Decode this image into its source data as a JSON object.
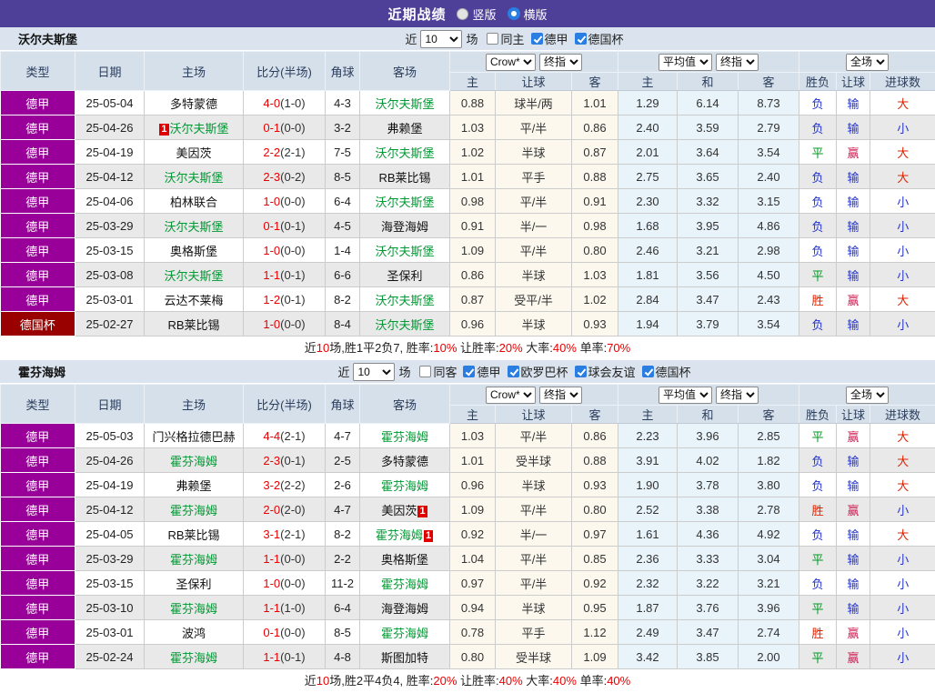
{
  "title_bar": {
    "title": "近期战绩",
    "radios": [
      {
        "label": "竖版",
        "checked": false,
        "name": "vertical-layout-radio"
      },
      {
        "label": "横版",
        "checked": true,
        "name": "horizontal-layout-radio"
      }
    ]
  },
  "colors": {
    "topbar_bg": "#4e4099",
    "accent_blue": "#2a7de1",
    "filter_bar_bg": "#dbe4ee",
    "header_bg": "#d6e0ea",
    "row_alt_bg": "#e9e9e9",
    "handicap_col_bg": "#fcf8ee",
    "avg_col_bg": "#e8f3fa",
    "self_team_green": "#009933",
    "score_red": "#e80000",
    "league": {
      "德甲": "#990099",
      "德国杯": "#990000"
    },
    "result": {
      "胜": "#dd2200",
      "平": "#009922",
      "负": "#2233cc",
      "赢": "#cc2255",
      "输": "#2233cc",
      "大": "#dd2200",
      "小": "#2233cc"
    }
  },
  "table_headers": {
    "fixed": [
      "类型",
      "日期",
      "主场",
      "比分(半场)",
      "角球",
      "客场"
    ],
    "sub": [
      "主",
      "让球",
      "客",
      "主",
      "和",
      "客",
      "胜负",
      "让球",
      "进球数"
    ]
  },
  "header_groups": [
    {
      "name": "handicap-odds-group",
      "selects": [
        {
          "label": "Crow*",
          "name": "bookmaker-select"
        },
        {
          "label": "终指",
          "name": "handicap-time-select"
        }
      ]
    },
    {
      "name": "average-odds-group",
      "selects": [
        {
          "label": "平均值",
          "name": "average-source-select"
        },
        {
          "label": "终指",
          "name": "average-time-select"
        }
      ]
    },
    {
      "name": "result-group",
      "selects": [
        {
          "label": "全场",
          "name": "result-scope-select"
        }
      ]
    }
  ],
  "sections": [
    {
      "team": "沃尔夫斯堡",
      "filter": {
        "near_label": "近",
        "games": "10",
        "games_suffix": "场",
        "checkboxes": [
          {
            "label": "同主",
            "checked": false,
            "name": "same-home-checkbox"
          },
          {
            "label": "德甲",
            "checked": true,
            "name": "league-bundesliga-checkbox"
          },
          {
            "label": "德国杯",
            "checked": true,
            "name": "league-dfb-pokal-checkbox"
          }
        ]
      },
      "rows": [
        {
          "type": "德甲",
          "date": "25-05-04",
          "home": {
            "name": "多特蒙德"
          },
          "score": {
            "ft": "4-0",
            "ht": "(1-0)"
          },
          "corner": "4-3",
          "away": {
            "name": "沃尔夫斯堡",
            "self": true
          },
          "odds": [
            "0.88",
            "球半/两",
            "1.01"
          ],
          "avg": [
            "1.29",
            "6.14",
            "8.73"
          ],
          "results": [
            "负",
            "输",
            "大"
          ]
        },
        {
          "type": "德甲",
          "date": "25-04-26",
          "home": {
            "name": "沃尔夫斯堡",
            "self": true,
            "badge": "1",
            "badge_pos": "before"
          },
          "score": {
            "ft": "0-1",
            "ht": "(0-0)"
          },
          "corner": "3-2",
          "away": {
            "name": "弗赖堡"
          },
          "odds": [
            "1.03",
            "平/半",
            "0.86"
          ],
          "avg": [
            "2.40",
            "3.59",
            "2.79"
          ],
          "results": [
            "负",
            "输",
            "小"
          ]
        },
        {
          "type": "德甲",
          "date": "25-04-19",
          "home": {
            "name": "美因茨"
          },
          "score": {
            "ft": "2-2",
            "ht": "(2-1)"
          },
          "corner": "7-5",
          "away": {
            "name": "沃尔夫斯堡",
            "self": true
          },
          "odds": [
            "1.02",
            "半球",
            "0.87"
          ],
          "avg": [
            "2.01",
            "3.64",
            "3.54"
          ],
          "results": [
            "平",
            "赢",
            "大"
          ]
        },
        {
          "type": "德甲",
          "date": "25-04-12",
          "home": {
            "name": "沃尔夫斯堡",
            "self": true
          },
          "score": {
            "ft": "2-3",
            "ht": "(0-2)"
          },
          "corner": "8-5",
          "away": {
            "name": "RB莱比锡"
          },
          "odds": [
            "1.01",
            "平手",
            "0.88"
          ],
          "avg": [
            "2.75",
            "3.65",
            "2.40"
          ],
          "results": [
            "负",
            "输",
            "大"
          ]
        },
        {
          "type": "德甲",
          "date": "25-04-06",
          "home": {
            "name": "柏林联合"
          },
          "score": {
            "ft": "1-0",
            "ht": "(0-0)"
          },
          "corner": "6-4",
          "away": {
            "name": "沃尔夫斯堡",
            "self": true
          },
          "odds": [
            "0.98",
            "平/半",
            "0.91"
          ],
          "avg": [
            "2.30",
            "3.32",
            "3.15"
          ],
          "results": [
            "负",
            "输",
            "小"
          ]
        },
        {
          "type": "德甲",
          "date": "25-03-29",
          "home": {
            "name": "沃尔夫斯堡",
            "self": true
          },
          "score": {
            "ft": "0-1",
            "ht": "(0-1)"
          },
          "corner": "4-5",
          "away": {
            "name": "海登海姆"
          },
          "odds": [
            "0.91",
            "半/一",
            "0.98"
          ],
          "avg": [
            "1.68",
            "3.95",
            "4.86"
          ],
          "results": [
            "负",
            "输",
            "小"
          ]
        },
        {
          "type": "德甲",
          "date": "25-03-15",
          "home": {
            "name": "奥格斯堡"
          },
          "score": {
            "ft": "1-0",
            "ht": "(0-0)"
          },
          "corner": "1-4",
          "away": {
            "name": "沃尔夫斯堡",
            "self": true
          },
          "odds": [
            "1.09",
            "平/半",
            "0.80"
          ],
          "avg": [
            "2.46",
            "3.21",
            "2.98"
          ],
          "results": [
            "负",
            "输",
            "小"
          ]
        },
        {
          "type": "德甲",
          "date": "25-03-08",
          "home": {
            "name": "沃尔夫斯堡",
            "self": true
          },
          "score": {
            "ft": "1-1",
            "ht": "(0-1)"
          },
          "corner": "6-6",
          "away": {
            "name": "圣保利"
          },
          "odds": [
            "0.86",
            "半球",
            "1.03"
          ],
          "avg": [
            "1.81",
            "3.56",
            "4.50"
          ],
          "results": [
            "平",
            "输",
            "小"
          ]
        },
        {
          "type": "德甲",
          "date": "25-03-01",
          "home": {
            "name": "云达不莱梅"
          },
          "score": {
            "ft": "1-2",
            "ht": "(0-1)"
          },
          "corner": "8-2",
          "away": {
            "name": "沃尔夫斯堡",
            "self": true
          },
          "odds": [
            "0.87",
            "受平/半",
            "1.02"
          ],
          "avg": [
            "2.84",
            "3.47",
            "2.43"
          ],
          "results": [
            "胜",
            "赢",
            "大"
          ]
        },
        {
          "type": "德国杯",
          "date": "25-02-27",
          "home": {
            "name": "RB莱比锡"
          },
          "score": {
            "ft": "1-0",
            "ht": "(0-0)"
          },
          "corner": "8-4",
          "away": {
            "name": "沃尔夫斯堡",
            "self": true
          },
          "odds": [
            "0.96",
            "半球",
            "0.93"
          ],
          "avg": [
            "1.94",
            "3.79",
            "3.54"
          ],
          "results": [
            "负",
            "输",
            "小"
          ]
        }
      ],
      "summary": [
        {
          "text": "近"
        },
        {
          "text": "10",
          "red": true
        },
        {
          "text": "场,胜1平2负7, 胜率:"
        },
        {
          "text": "10%",
          "red": true
        },
        {
          "text": " 让胜率:"
        },
        {
          "text": "20%",
          "red": true
        },
        {
          "text": " 大率:"
        },
        {
          "text": "40%",
          "red": true
        },
        {
          "text": " 单率:"
        },
        {
          "text": "70%",
          "red": true
        }
      ]
    },
    {
      "team": "霍芬海姆",
      "filter": {
        "near_label": "近",
        "games": "10",
        "games_suffix": "场",
        "checkboxes": [
          {
            "label": "同客",
            "checked": false,
            "name": "same-away-checkbox"
          },
          {
            "label": "德甲",
            "checked": true,
            "name": "league-bundesliga-checkbox"
          },
          {
            "label": "欧罗巴杯",
            "checked": true,
            "name": "league-europa-checkbox"
          },
          {
            "label": "球会友谊",
            "checked": true,
            "name": "league-friendly-checkbox"
          },
          {
            "label": "德国杯",
            "checked": true,
            "name": "league-dfb-pokal-checkbox"
          }
        ]
      },
      "rows": [
        {
          "type": "德甲",
          "date": "25-05-03",
          "home": {
            "name": "门兴格拉德巴赫"
          },
          "score": {
            "ft": "4-4",
            "ht": "(2-1)"
          },
          "corner": "4-7",
          "away": {
            "name": "霍芬海姆",
            "self": true
          },
          "odds": [
            "1.03",
            "平/半",
            "0.86"
          ],
          "avg": [
            "2.23",
            "3.96",
            "2.85"
          ],
          "results": [
            "平",
            "赢",
            "大"
          ]
        },
        {
          "type": "德甲",
          "date": "25-04-26",
          "home": {
            "name": "霍芬海姆",
            "self": true
          },
          "score": {
            "ft": "2-3",
            "ht": "(0-1)"
          },
          "corner": "2-5",
          "away": {
            "name": "多特蒙德"
          },
          "odds": [
            "1.01",
            "受半球",
            "0.88"
          ],
          "avg": [
            "3.91",
            "4.02",
            "1.82"
          ],
          "results": [
            "负",
            "输",
            "大"
          ]
        },
        {
          "type": "德甲",
          "date": "25-04-19",
          "home": {
            "name": "弗赖堡"
          },
          "score": {
            "ft": "3-2",
            "ht": "(2-2)"
          },
          "corner": "2-6",
          "away": {
            "name": "霍芬海姆",
            "self": true
          },
          "odds": [
            "0.96",
            "半球",
            "0.93"
          ],
          "avg": [
            "1.90",
            "3.78",
            "3.80"
          ],
          "results": [
            "负",
            "输",
            "大"
          ]
        },
        {
          "type": "德甲",
          "date": "25-04-12",
          "home": {
            "name": "霍芬海姆",
            "self": true
          },
          "score": {
            "ft": "2-0",
            "ht": "(2-0)"
          },
          "corner": "4-7",
          "away": {
            "name": "美因茨",
            "badge": "1",
            "badge_pos": "after"
          },
          "odds": [
            "1.09",
            "平/半",
            "0.80"
          ],
          "avg": [
            "2.52",
            "3.38",
            "2.78"
          ],
          "results": [
            "胜",
            "赢",
            "小"
          ]
        },
        {
          "type": "德甲",
          "date": "25-04-05",
          "home": {
            "name": "RB莱比锡"
          },
          "score": {
            "ft": "3-1",
            "ht": "(2-1)"
          },
          "corner": "8-2",
          "away": {
            "name": "霍芬海姆",
            "self": true,
            "badge": "1",
            "badge_pos": "after"
          },
          "odds": [
            "0.92",
            "半/一",
            "0.97"
          ],
          "avg": [
            "1.61",
            "4.36",
            "4.92"
          ],
          "results": [
            "负",
            "输",
            "大"
          ]
        },
        {
          "type": "德甲",
          "date": "25-03-29",
          "home": {
            "name": "霍芬海姆",
            "self": true
          },
          "score": {
            "ft": "1-1",
            "ht": "(0-0)"
          },
          "corner": "2-2",
          "away": {
            "name": "奥格斯堡"
          },
          "odds": [
            "1.04",
            "平/半",
            "0.85"
          ],
          "avg": [
            "2.36",
            "3.33",
            "3.04"
          ],
          "results": [
            "平",
            "输",
            "小"
          ]
        },
        {
          "type": "德甲",
          "date": "25-03-15",
          "home": {
            "name": "圣保利"
          },
          "score": {
            "ft": "1-0",
            "ht": "(0-0)"
          },
          "corner": "11-2",
          "away": {
            "name": "霍芬海姆",
            "self": true
          },
          "odds": [
            "0.97",
            "平/半",
            "0.92"
          ],
          "avg": [
            "2.32",
            "3.22",
            "3.21"
          ],
          "results": [
            "负",
            "输",
            "小"
          ]
        },
        {
          "type": "德甲",
          "date": "25-03-10",
          "home": {
            "name": "霍芬海姆",
            "self": true
          },
          "score": {
            "ft": "1-1",
            "ht": "(1-0)"
          },
          "corner": "6-4",
          "away": {
            "name": "海登海姆"
          },
          "odds": [
            "0.94",
            "半球",
            "0.95"
          ],
          "avg": [
            "1.87",
            "3.76",
            "3.96"
          ],
          "results": [
            "平",
            "输",
            "小"
          ]
        },
        {
          "type": "德甲",
          "date": "25-03-01",
          "home": {
            "name": "波鸿"
          },
          "score": {
            "ft": "0-1",
            "ht": "(0-0)"
          },
          "corner": "8-5",
          "away": {
            "name": "霍芬海姆",
            "self": true
          },
          "odds": [
            "0.78",
            "平手",
            "1.12"
          ],
          "avg": [
            "2.49",
            "3.47",
            "2.74"
          ],
          "results": [
            "胜",
            "赢",
            "小"
          ]
        },
        {
          "type": "德甲",
          "date": "25-02-24",
          "home": {
            "name": "霍芬海姆",
            "self": true
          },
          "score": {
            "ft": "1-1",
            "ht": "(0-1)"
          },
          "corner": "4-8",
          "away": {
            "name": "斯图加特"
          },
          "odds": [
            "0.80",
            "受半球",
            "1.09"
          ],
          "avg": [
            "3.42",
            "3.85",
            "2.00"
          ],
          "results": [
            "平",
            "赢",
            "小"
          ]
        }
      ],
      "summary": [
        {
          "text": "近"
        },
        {
          "text": "10",
          "red": true
        },
        {
          "text": "场,胜2平4负4, 胜率:"
        },
        {
          "text": "20%",
          "red": true
        },
        {
          "text": " 让胜率:"
        },
        {
          "text": "40%",
          "red": true
        },
        {
          "text": " 大率:"
        },
        {
          "text": "40%",
          "red": true
        },
        {
          "text": " 单率:"
        },
        {
          "text": "40%",
          "red": true
        }
      ]
    }
  ]
}
